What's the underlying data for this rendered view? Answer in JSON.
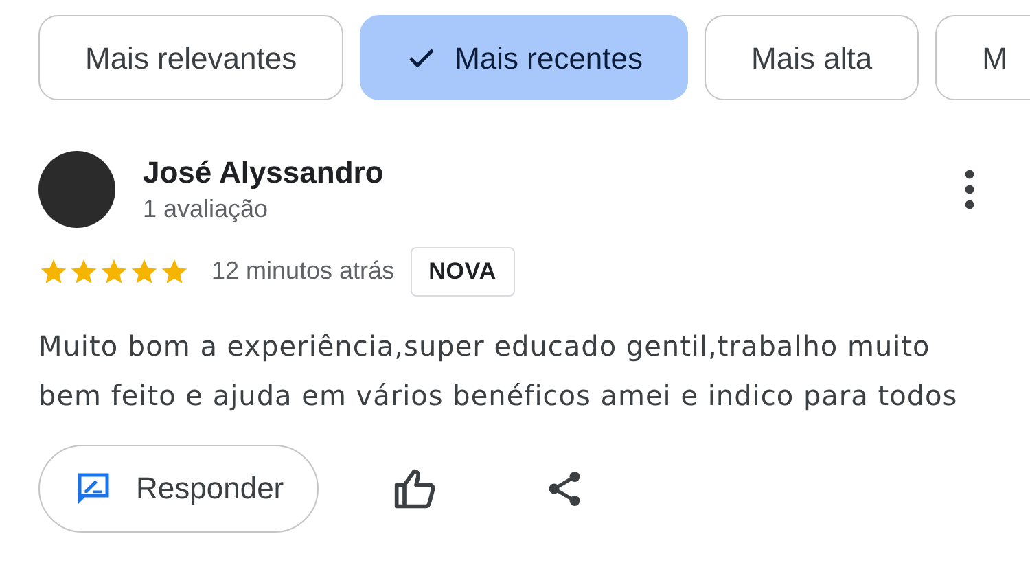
{
  "filter_chips": [
    {
      "label": "Mais relevantes",
      "selected": false
    },
    {
      "label": "Mais recentes",
      "selected": true
    },
    {
      "label": "Mais alta",
      "selected": false
    },
    {
      "label": "M",
      "selected": false
    }
  ],
  "review": {
    "author": "José Alyssandro",
    "author_meta": "1 avaliação",
    "stars": 5,
    "time": "12 minutos atrás",
    "badge": "NOVA",
    "text": "Muito bom a experiência,super educado gentil,trabalho muito bem feito e ajuda em vários benéficos amei e indico para todos"
  },
  "actions": {
    "reply_label": "Responder"
  }
}
